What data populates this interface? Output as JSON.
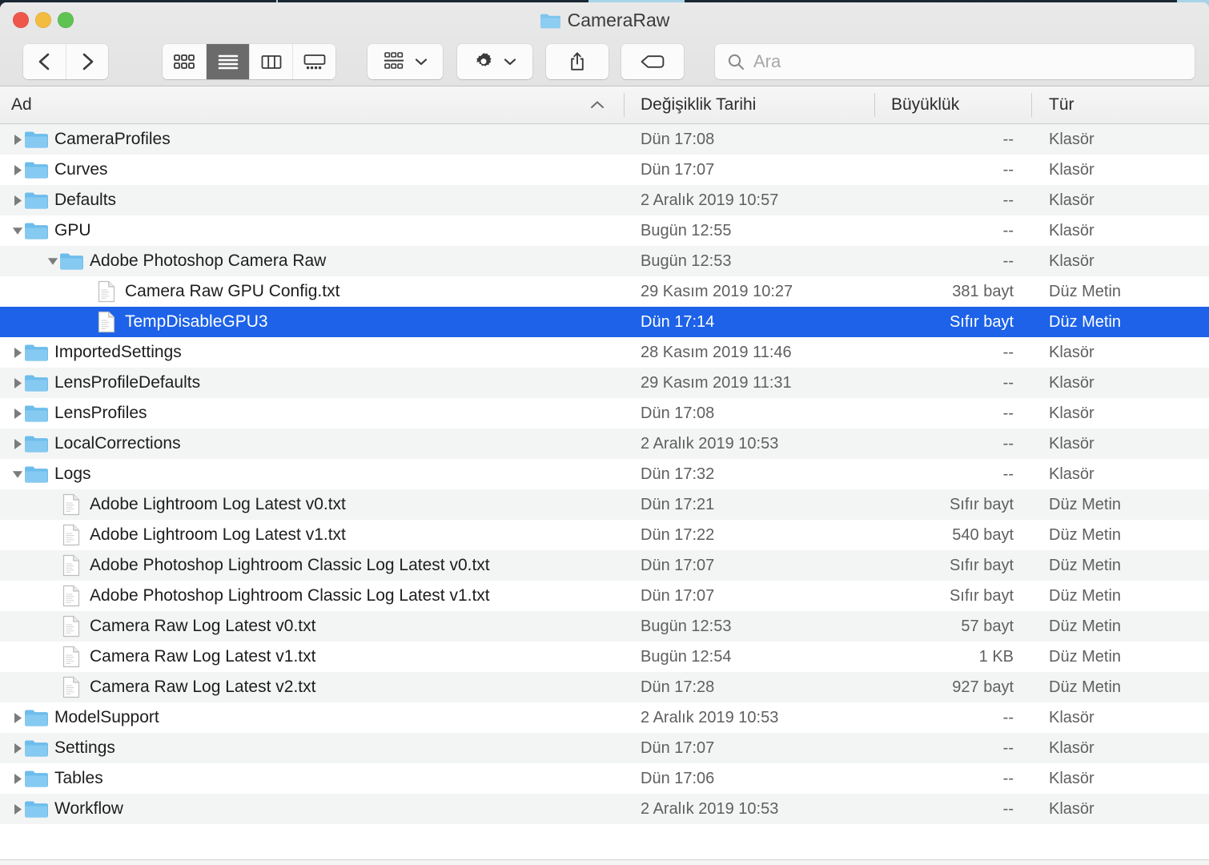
{
  "window": {
    "title": "CameraRaw",
    "title_icon": "folder-icon",
    "traffic_lights": [
      {
        "name": "close-button",
        "color": "#f0574c"
      },
      {
        "name": "minimize-button",
        "color": "#f2bc40"
      },
      {
        "name": "maximize-button",
        "color": "#5ec353"
      }
    ]
  },
  "toolbar": {
    "back_label": "Geri",
    "forward_label": "İleri",
    "view_icon_label": "Simge Görünümü",
    "view_list_label": "Liste Görünümü",
    "view_column_label": "Sütun Görünümü",
    "view_gallery_label": "Galeri Görünümü",
    "active_view": "list",
    "arrange_label": "Grupla",
    "action_label": "İşlem",
    "share_label": "Paylaş",
    "tag_label": "Etiketle"
  },
  "search": {
    "placeholder": "Ara",
    "value": "",
    "icon": "search-icon"
  },
  "columns": [
    {
      "key": "name",
      "label": "Ad",
      "sorted": true,
      "sort_direction": "ascending"
    },
    {
      "key": "date",
      "label": "Değişiklik Tarihi",
      "sorted": false
    },
    {
      "key": "size",
      "label": "Büyüklük",
      "sorted": false
    },
    {
      "key": "kind",
      "label": "Tür",
      "sorted": false
    }
  ],
  "colors": {
    "selection": "#1d62e8",
    "row_alt": "#f3f5f5",
    "row_base": "#ffffff",
    "folder_blue": "#73c1ef",
    "header_bg": "#f2f2f2"
  },
  "rows": [
    {
      "name": "CameraProfiles",
      "date": "Dün 17:08",
      "size": "--",
      "kind": "Klasör",
      "icon": "folder-icon",
      "depth": 0,
      "disclosure": "collapsed",
      "selected": false
    },
    {
      "name": "Curves",
      "date": "Dün 17:07",
      "size": "--",
      "kind": "Klasör",
      "icon": "folder-icon",
      "depth": 0,
      "disclosure": "collapsed",
      "selected": false
    },
    {
      "name": "Defaults",
      "date": "2 Aralık 2019 10:57",
      "size": "--",
      "kind": "Klasör",
      "icon": "folder-icon",
      "depth": 0,
      "disclosure": "collapsed",
      "selected": false
    },
    {
      "name": "GPU",
      "date": "Bugün 12:55",
      "size": "--",
      "kind": "Klasör",
      "icon": "folder-icon",
      "depth": 0,
      "disclosure": "expanded",
      "selected": false
    },
    {
      "name": "Adobe Photoshop Camera Raw",
      "date": "Bugün 12:53",
      "size": "--",
      "kind": "Klasör",
      "icon": "folder-icon",
      "depth": 1,
      "disclosure": "expanded",
      "selected": false
    },
    {
      "name": "Camera Raw GPU Config.txt",
      "date": "29 Kasım 2019 10:27",
      "size": "381 bayt",
      "kind": "Düz Metin",
      "icon": "document-icon",
      "depth": 2,
      "disclosure": "none",
      "selected": false
    },
    {
      "name": "TempDisableGPU3",
      "date": "Dün 17:14",
      "size": "Sıfır bayt",
      "kind": "Düz Metin",
      "icon": "document-icon",
      "depth": 2,
      "disclosure": "none",
      "selected": true
    },
    {
      "name": "ImportedSettings",
      "date": "28 Kasım 2019 11:46",
      "size": "--",
      "kind": "Klasör",
      "icon": "folder-icon",
      "depth": 0,
      "disclosure": "collapsed",
      "selected": false
    },
    {
      "name": "LensProfileDefaults",
      "date": "29 Kasım 2019 11:31",
      "size": "--",
      "kind": "Klasör",
      "icon": "folder-icon",
      "depth": 0,
      "disclosure": "collapsed",
      "selected": false
    },
    {
      "name": "LensProfiles",
      "date": "Dün 17:08",
      "size": "--",
      "kind": "Klasör",
      "icon": "folder-icon",
      "depth": 0,
      "disclosure": "collapsed",
      "selected": false
    },
    {
      "name": "LocalCorrections",
      "date": "2 Aralık 2019 10:53",
      "size": "--",
      "kind": "Klasör",
      "icon": "folder-icon",
      "depth": 0,
      "disclosure": "collapsed",
      "selected": false
    },
    {
      "name": "Logs",
      "date": "Dün 17:32",
      "size": "--",
      "kind": "Klasör",
      "icon": "folder-icon",
      "depth": 0,
      "disclosure": "expanded",
      "selected": false
    },
    {
      "name": "Adobe Lightroom Log Latest v0.txt",
      "date": "Dün 17:21",
      "size": "Sıfır bayt",
      "kind": "Düz Metin",
      "icon": "document-icon",
      "depth": 1,
      "disclosure": "none",
      "selected": false
    },
    {
      "name": "Adobe Lightroom Log Latest v1.txt",
      "date": "Dün 17:22",
      "size": "540 bayt",
      "kind": "Düz Metin",
      "icon": "document-icon",
      "depth": 1,
      "disclosure": "none",
      "selected": false
    },
    {
      "name": "Adobe Photoshop Lightroom Classic Log Latest v0.txt",
      "date": "Dün 17:07",
      "size": "Sıfır bayt",
      "kind": "Düz Metin",
      "icon": "document-icon",
      "depth": 1,
      "disclosure": "none",
      "selected": false
    },
    {
      "name": "Adobe Photoshop Lightroom Classic Log Latest v1.txt",
      "date": "Dün 17:07",
      "size": "Sıfır bayt",
      "kind": "Düz Metin",
      "icon": "document-icon",
      "depth": 1,
      "disclosure": "none",
      "selected": false
    },
    {
      "name": "Camera Raw Log Latest v0.txt",
      "date": "Bugün 12:53",
      "size": "57 bayt",
      "kind": "Düz Metin",
      "icon": "document-icon",
      "depth": 1,
      "disclosure": "none",
      "selected": false
    },
    {
      "name": "Camera Raw Log Latest v1.txt",
      "date": "Bugün 12:54",
      "size": "1 KB",
      "kind": "Düz Metin",
      "icon": "document-icon",
      "depth": 1,
      "disclosure": "none",
      "selected": false
    },
    {
      "name": "Camera Raw Log Latest v2.txt",
      "date": "Dün 17:28",
      "size": "927 bayt",
      "kind": "Düz Metin",
      "icon": "document-icon",
      "depth": 1,
      "disclosure": "none",
      "selected": false
    },
    {
      "name": "ModelSupport",
      "date": "2 Aralık 2019 10:53",
      "size": "--",
      "kind": "Klasör",
      "icon": "folder-icon",
      "depth": 0,
      "disclosure": "collapsed",
      "selected": false
    },
    {
      "name": "Settings",
      "date": "Dün 17:07",
      "size": "--",
      "kind": "Klasör",
      "icon": "folder-icon",
      "depth": 0,
      "disclosure": "collapsed",
      "selected": false
    },
    {
      "name": "Tables",
      "date": "Dün 17:06",
      "size": "--",
      "kind": "Klasör",
      "icon": "folder-icon",
      "depth": 0,
      "disclosure": "collapsed",
      "selected": false
    },
    {
      "name": "Workflow",
      "date": "2 Aralık 2019 10:53",
      "size": "--",
      "kind": "Klasör",
      "icon": "folder-icon",
      "depth": 0,
      "disclosure": "collapsed",
      "selected": false
    }
  ]
}
